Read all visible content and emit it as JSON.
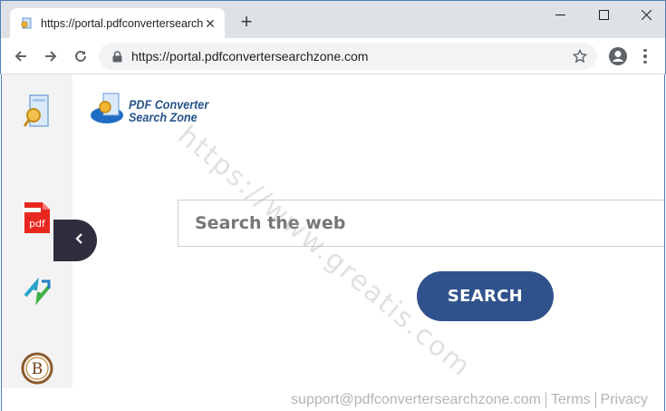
{
  "browser": {
    "tab_title": "https://portal.pdfconvertersearch",
    "tab_close": "✕",
    "new_tab": "+",
    "url": "https://portal.pdfconvertersearchzone.com"
  },
  "logo": {
    "line1": "PDF Converter",
    "line2": "Search Zone"
  },
  "search": {
    "placeholder": "Search the web",
    "button_label": "SEARCH"
  },
  "watermark": "https://www.greatis.com",
  "footer": {
    "email": "support@pdfconvertersearchzone.com",
    "terms": "Terms",
    "privacy": "Privacy"
  },
  "colors": {
    "brand": "#30528c",
    "sidebar_bg": "#f3f3f3",
    "collapse_bg": "#2e2e3e"
  }
}
